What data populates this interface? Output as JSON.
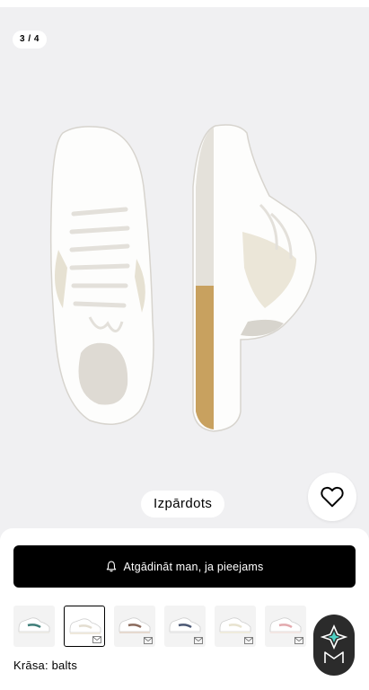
{
  "gallery": {
    "counter": "3 / 4",
    "image_icon": "sneaker-pair-image",
    "sold_badge": "Izpārdots",
    "wishlist_icon": "heart-icon"
  },
  "purchase": {
    "notify_label": "Atgādināt man, ja pieejams",
    "notify_icon": "bell-icon"
  },
  "swatches": [
    {
      "name": "white-green",
      "accent": "#3e7d78",
      "selected": false
    },
    {
      "name": "white-sail",
      "accent": "#e3ddd0",
      "selected": true
    },
    {
      "name": "white-brown",
      "accent": "#8a6a5c",
      "selected": false
    },
    {
      "name": "white-navy",
      "accent": "#4a5773",
      "selected": false
    },
    {
      "name": "white-cream",
      "accent": "#e8e3cf",
      "selected": false
    },
    {
      "name": "white-pink",
      "accent": "#e3a9ad",
      "selected": false
    }
  ],
  "color": {
    "label": "Krāsa: balts"
  },
  "chat": {
    "icon": "assistant-logo-icon"
  },
  "colors": {
    "background": "#f0f0f2",
    "button": "#000000",
    "sole_gum": "#c8a15f"
  }
}
